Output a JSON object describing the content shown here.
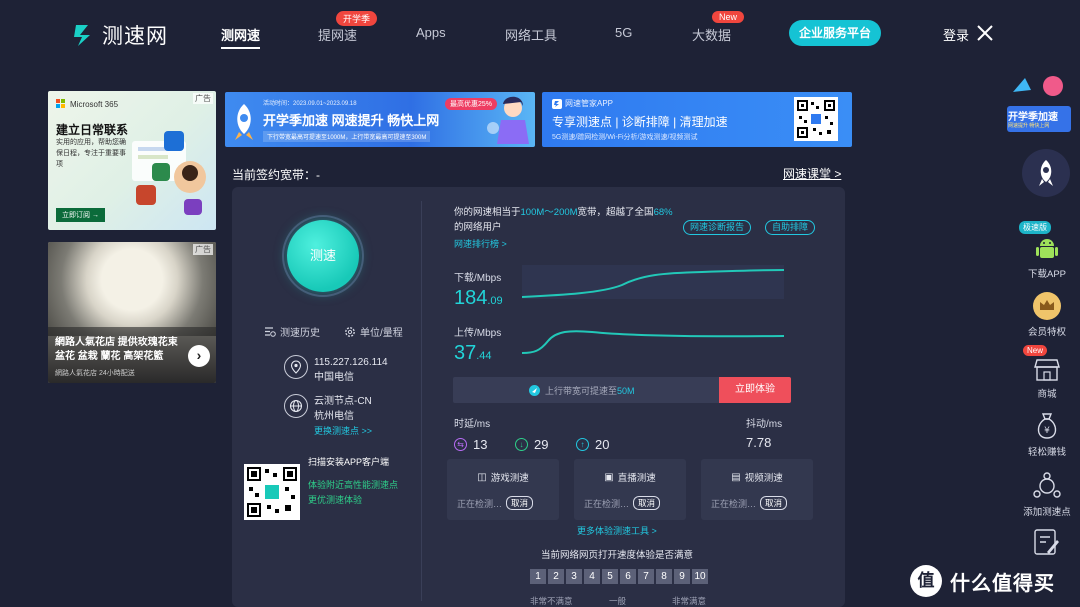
{
  "nav": {
    "logo_text": "测速网",
    "items": [
      {
        "label": "测网速",
        "active": true
      },
      {
        "label": "提网速",
        "badge": "开学季"
      },
      {
        "label": "Apps"
      },
      {
        "label": "网络工具"
      },
      {
        "label": "5G"
      },
      {
        "label": "大数据",
        "badge": "New"
      }
    ],
    "enterprise_label": "企业服务平台",
    "login_label": "登录"
  },
  "ads": {
    "ad1": {
      "tag": "广告",
      "brand": "Microsoft 365",
      "title": "建立日常联系",
      "desc": "实用的应用，帮助您确保日程，专注于重要事项",
      "cta": "立即订阅 →"
    },
    "ad2": {
      "tag": "广告",
      "title": "網路人氣花店 提供玫瑰花束 盆花 盆栽 蘭花 高架花籃",
      "sub": "網路人氣花店 24小時配送"
    }
  },
  "banners": {
    "b1": {
      "date": "活动时间：2023.09.01~2023.09.18",
      "badge": "最高优惠25%",
      "title": "开学季加速  网速提升 畅快上网",
      "sub": "下行带宽最高可提速至1000M，上行带宽最高可提速至300M"
    },
    "b2": {
      "app": "网速管家APP",
      "title": "专享测速点 | 诊断排障 | 清理加速",
      "sub": "5G测速/蹭网检测/Wi-Fi分析/游戏测速/视频测试"
    }
  },
  "contract": {
    "label": "当前签约宽带：-",
    "course_link": "网速课堂 >"
  },
  "left": {
    "speed_button": "测速",
    "history": "测速历史",
    "unit": "单位/量程",
    "ip": "115.227.126.114",
    "isp": "中国电信",
    "node": "云测节点-CN",
    "node_isp": "杭州电信",
    "change_node": "更换测速点 >>",
    "qr_title": "扫描安装APP客户端",
    "qr_line1": "体验附近高性能测速点",
    "qr_line2": "更优测速体验"
  },
  "result": {
    "prefix": "你的网速相当于",
    "range": "100M～200M",
    "middle": "宽带，超越了全国",
    "percent": "68%",
    "suffix": "的网络用户",
    "rank_link": "网速排行榜 >",
    "diagnose": "网速诊断报告",
    "troubleshoot": "自助排障"
  },
  "download": {
    "label": "下载/Mbps",
    "int": "184",
    "dec": ".09"
  },
  "upload": {
    "label": "上传/Mbps",
    "int": "37",
    "dec": ".44"
  },
  "promo": {
    "text": "上行带宽可提速至",
    "highlight": "50M",
    "button": "立即体验"
  },
  "latency": {
    "label": "时延/ms",
    "values": [
      "13",
      "29",
      "20"
    ],
    "jitter_label": "抖动/ms",
    "jitter": "7.78"
  },
  "cards": [
    {
      "title": "游戏测速",
      "status": "正在检测…",
      "cancel": "取消"
    },
    {
      "title": "直播测速",
      "status": "正在检测…",
      "cancel": "取消"
    },
    {
      "title": "视频测速",
      "status": "正在检测…",
      "cancel": "取消"
    }
  ],
  "more_tools": "更多体验测速工具 >",
  "survey": {
    "question": "当前网络网页打开速度体验是否满意",
    "scale": [
      "1",
      "2",
      "3",
      "4",
      "5",
      "6",
      "7",
      "8",
      "9",
      "10"
    ],
    "low": "非常不满意",
    "mid": "一般",
    "high": "非常满意"
  },
  "sidebar": {
    "promo_text": "开学季加速",
    "promo_sub": "网速提升 畅快上网",
    "items": [
      {
        "label": "下载APP",
        "badge": "极速版"
      },
      {
        "label": "会员特权"
      },
      {
        "label": "商城",
        "badge": "New"
      },
      {
        "label": "轻松赚钱"
      },
      {
        "label": "添加测速点"
      }
    ]
  },
  "watermark": {
    "symbol": "值",
    "text": "什么值得买"
  },
  "colors": {
    "accent": "#22c8e0",
    "brand_green": "#18c9b8",
    "cta_red": "#ef4f5b",
    "background": "#1e2236"
  }
}
